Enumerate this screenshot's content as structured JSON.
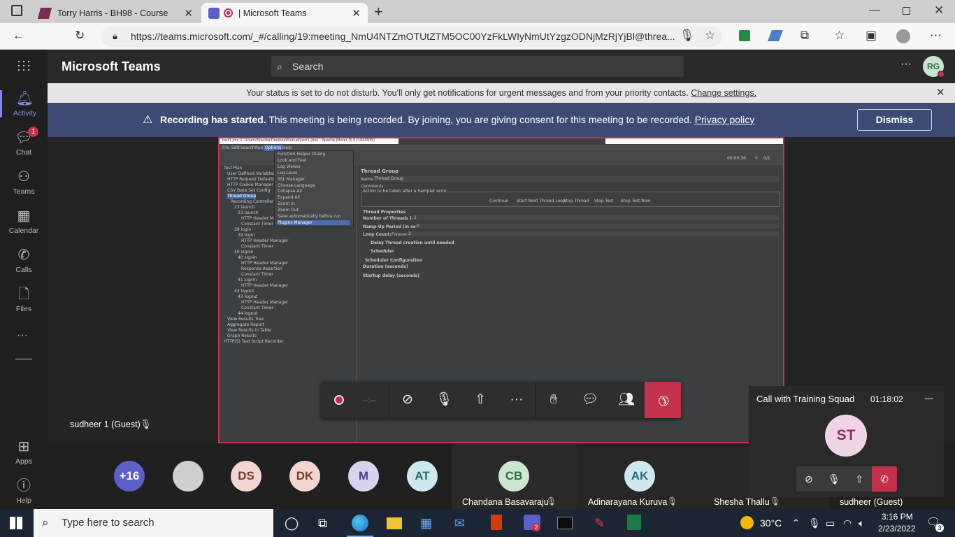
{
  "browser": {
    "tabs": [
      {
        "title": "Torry Harris - BH98 - Course"
      },
      {
        "title": "| Microsoft Teams"
      }
    ],
    "url": "https://teams.microsoft.com/_#/calling/19:meeting_NmU4NTZmOTUtZTM5OC00YzFkLWIyNmUtYzgzODNjMzRjYjBl@threa..."
  },
  "teams": {
    "app_title": "Microsoft Teams",
    "search_placeholder": "Search",
    "user_initials": "RG",
    "rail": [
      {
        "label": "Activity"
      },
      {
        "label": "Chat",
        "badge": "1"
      },
      {
        "label": "Teams"
      },
      {
        "label": "Calendar"
      },
      {
        "label": "Calls"
      },
      {
        "label": "Files"
      },
      {
        "label": "Apps"
      },
      {
        "label": "Help"
      }
    ]
  },
  "banners": {
    "dnd_text": "Your status is set to do not disturb. You'll only get notifications for urgent messages and from your priority contacts.",
    "dnd_link": "Change settings.",
    "rec_title": "Recording has started.",
    "rec_text": "This meeting is being recorded. By joining, you are giving consent for this meeting to be recorded.",
    "rec_link": "Privacy policy",
    "dismiss": "Dismiss"
  },
  "meeting": {
    "presenter_label": "sudheer 1 (Guest)",
    "timer_placeholder": "--:--",
    "participants": [
      {
        "initials": "+16",
        "color": "#5b5fc7"
      },
      {
        "initials": "",
        "color": "#cfcfcf"
      },
      {
        "initials": "DS",
        "color": "#f3d6cf"
      },
      {
        "initials": "DK",
        "color": "#f3d6cf"
      },
      {
        "initials": "M",
        "color": "#d7d4ee"
      },
      {
        "initials": "AT",
        "color": "#cde8ef"
      }
    ],
    "tiles": [
      {
        "initials": "CB",
        "name": "Chandana Basavaraju",
        "color": "#cde6d0"
      },
      {
        "initials": "AK",
        "name": "Adinarayana Kuruva",
        "color": "#cde8ef"
      },
      {
        "initials": "",
        "name": "Shesha Thallu",
        "color": "#cde8ef"
      },
      {
        "initials": "",
        "name": "sudheer (Guest)",
        "color": "#cde8ef"
      }
    ]
  },
  "mini_call": {
    "title": "Call with Training Squad",
    "timer": "01:18:02",
    "initials": "ST"
  },
  "jmeter": {
    "window_title": "test1.jmx (C:\\Users\\Sravika\\Desktop\\Manual\\test1.jmx) - Apache JMeter (5.0 r1840935)",
    "menu": [
      "File",
      "Edit",
      "Search",
      "Run",
      "Options",
      "Help"
    ],
    "options_menu": [
      "Function Helper Dialog",
      "Look and Feel",
      "Log Viewer",
      "Log Level",
      "SSL Manager",
      "Choose Language",
      "Collapse All",
      "Expand All",
      "Zoom In",
      "Zoom Out",
      "Save automatically before run",
      "Plugins Manager"
    ],
    "tree": [
      "Test Plan",
      "User Defined Variables",
      "HTTP Request Defaults",
      "HTTP Cookie Manager",
      "CSV Data Set Config",
      "Thread Group",
      "Recording Controller",
      "23 launch",
      "23 launch",
      "HTTP Header Manager",
      "Constant Timer",
      "39 login",
      "39 login",
      "HTTP Header Manager",
      "Constant Timer",
      "40 signin",
      "40 signin",
      "HTTP Header Manager",
      "Response Assertion",
      "Constant Timer",
      "41 signin",
      "HTTP Header Manager",
      "43 logout",
      "43 logout",
      "HTTP Header Manager",
      "Constant Timer",
      "44 logout",
      "View Results Tree",
      "Aggregate Report",
      "View Results in Table",
      "Graph Results",
      "HTTP(S) Test Script Recorder"
    ],
    "panel_title": "Thread Group",
    "name_label": "Name:",
    "name_value": "Thread Group",
    "comments_label": "Comments:",
    "error_action": "Action to be taken after a Sampler error",
    "radios": [
      "Continue",
      "Start Next Thread Loop",
      "Stop Thread",
      "Stop Test",
      "Stop Test Now"
    ],
    "thread_props": "Thread Properties",
    "threads_label": "Number of Threads (users):",
    "threads_value": "1",
    "rampup_label": "Ramp-Up Period (in seconds):",
    "rampup_value": "0",
    "loop_label": "Loop Count:",
    "forever": "Forever",
    "loop_value": "2",
    "delay_label": "Delay Thread creation until needed",
    "scheduler_label": "Scheduler",
    "sched_config": "Scheduler Configuration",
    "duration_label": "Duration (seconds)",
    "startup_label": "Startup delay (seconds)",
    "time_counter": "00:00:36",
    "warn_count": "0",
    "thread_count": "0/1"
  },
  "taskbar": {
    "search_placeholder": "Type here to search",
    "temperature": "30°C",
    "time": "3:16 PM",
    "date": "2/23/2022",
    "teams_badge": "2",
    "notif_count": "3"
  },
  "colors": {
    "recording_banner": "#3d4a73",
    "hangup": "#c4314b",
    "teams_purple": "#5b5fc7"
  }
}
